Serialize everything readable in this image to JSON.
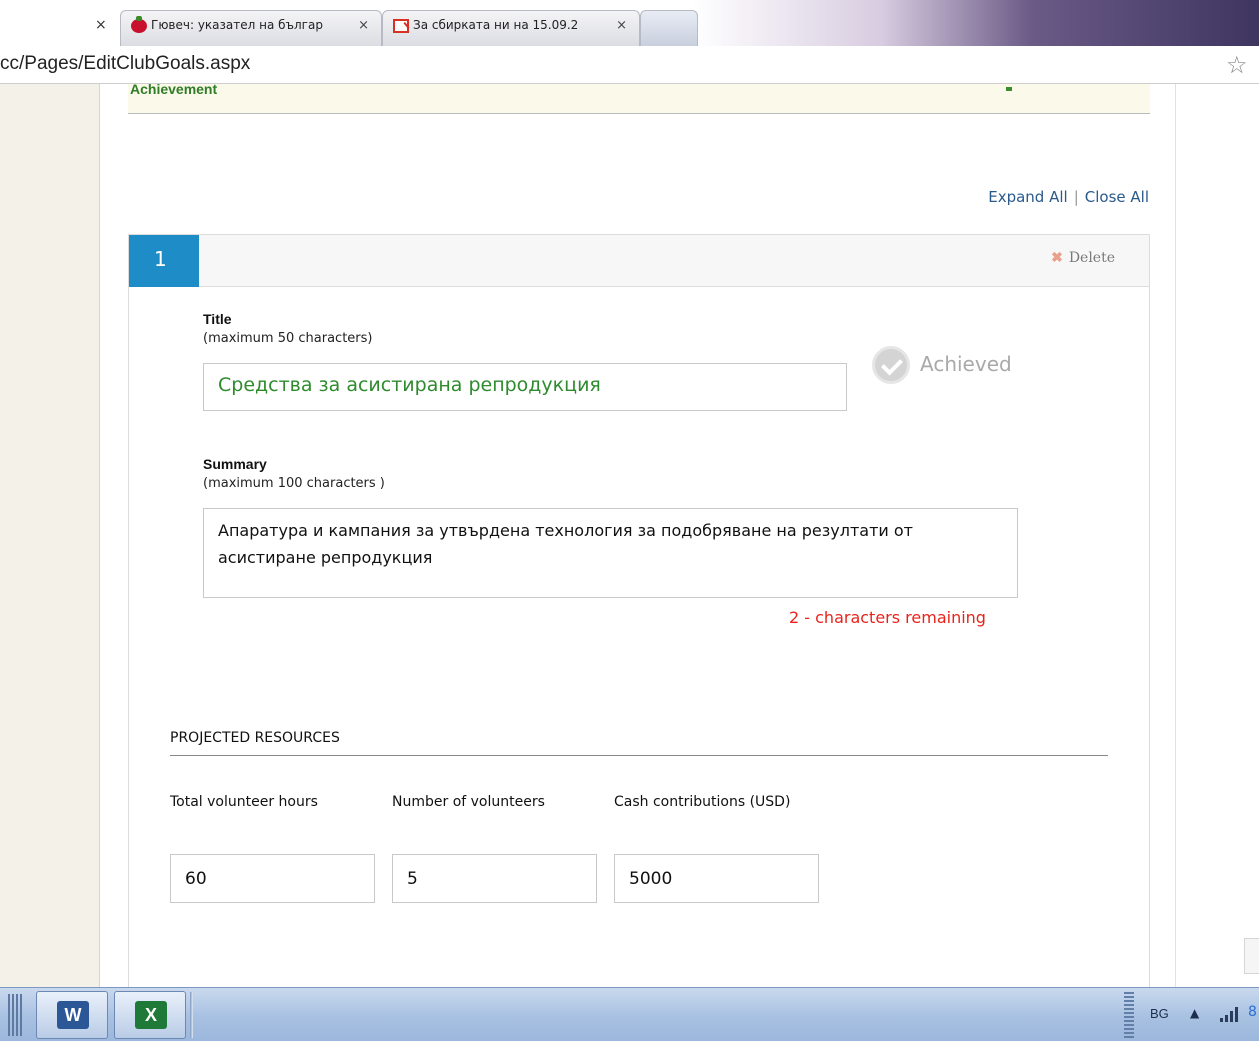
{
  "browser": {
    "tabs": [
      {
        "title": "",
        "close": "×"
      },
      {
        "title": "Гювеч: указател на българ",
        "close": "×",
        "favicon": "tomato-icon"
      },
      {
        "title": "За сбирката ни на 15.09.2",
        "close": "×",
        "favicon": "gmail-icon"
      },
      {
        "title": "",
        "close": ""
      }
    ],
    "url": "cc/Pages/EditClubGoals.aspx",
    "bookmark_star": "☆"
  },
  "page": {
    "achievement_label": "Achievement",
    "expand_all": "Expand All",
    "separator": "|",
    "close_all": "Close All",
    "goal": {
      "number": "1",
      "delete_icon": "✖",
      "delete_label": "Delete",
      "title_label": "Title",
      "title_hint": "(maximum 50 characters)",
      "title_value": "Средства за асистирана репродукция",
      "achieved_label": "Achieved",
      "summary_label": "Summary",
      "summary_hint": "(maximum 100 characters )",
      "summary_value": "Апаратура и кампания за утвърдена технология за подобряване на резултати от асистиране репродукция",
      "remaining_text": "2 - characters remaining",
      "resources_title": "PROJECTED RESOURCES",
      "resources": [
        {
          "label": "Total volunteer hours",
          "value": "60"
        },
        {
          "label": "Number of volunteers",
          "value": "5"
        },
        {
          "label": "Cash contributions (USD)",
          "value": "5000"
        }
      ]
    }
  },
  "taskbar": {
    "word_label": "W",
    "excel_label": "X",
    "language": "BG",
    "tray_arrow": "▲",
    "tray_edge": "8"
  },
  "colors": {
    "accent_blue": "#1e8dc7",
    "title_green": "#2e8b2e",
    "warning_red": "#e8231c",
    "link_blue": "#2a5a8c"
  }
}
